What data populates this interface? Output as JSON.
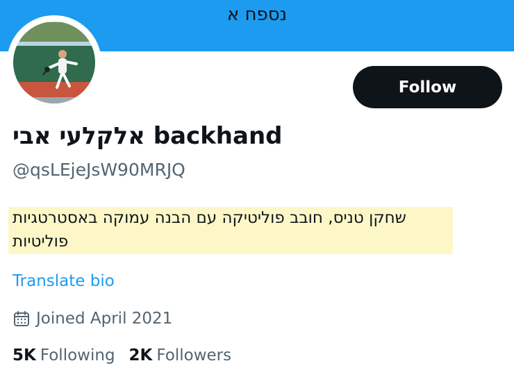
{
  "banner": {
    "label": "נספח א",
    "color": "#1d9bf0"
  },
  "profile": {
    "avatar_icon": "profile-photo-tennis-player",
    "follow_label": "Follow",
    "display_name": "אלקלעי אבי backhand",
    "handle": "@qsLEjeJsW90MRJQ",
    "bio_line1": "שחקן טניס, חובב פוליטיקה עם הבנה עמוקה באסטרטגיות",
    "bio_line2": "פוליטיות",
    "bio_highlight_color": "#fdf7c8",
    "translate_label": "Translate bio",
    "joined_icon": "calendar-icon",
    "joined_text": "Joined April 2021",
    "following_count": "5K",
    "following_label": "Following",
    "followers_count": "2K",
    "followers_label": "Followers"
  }
}
